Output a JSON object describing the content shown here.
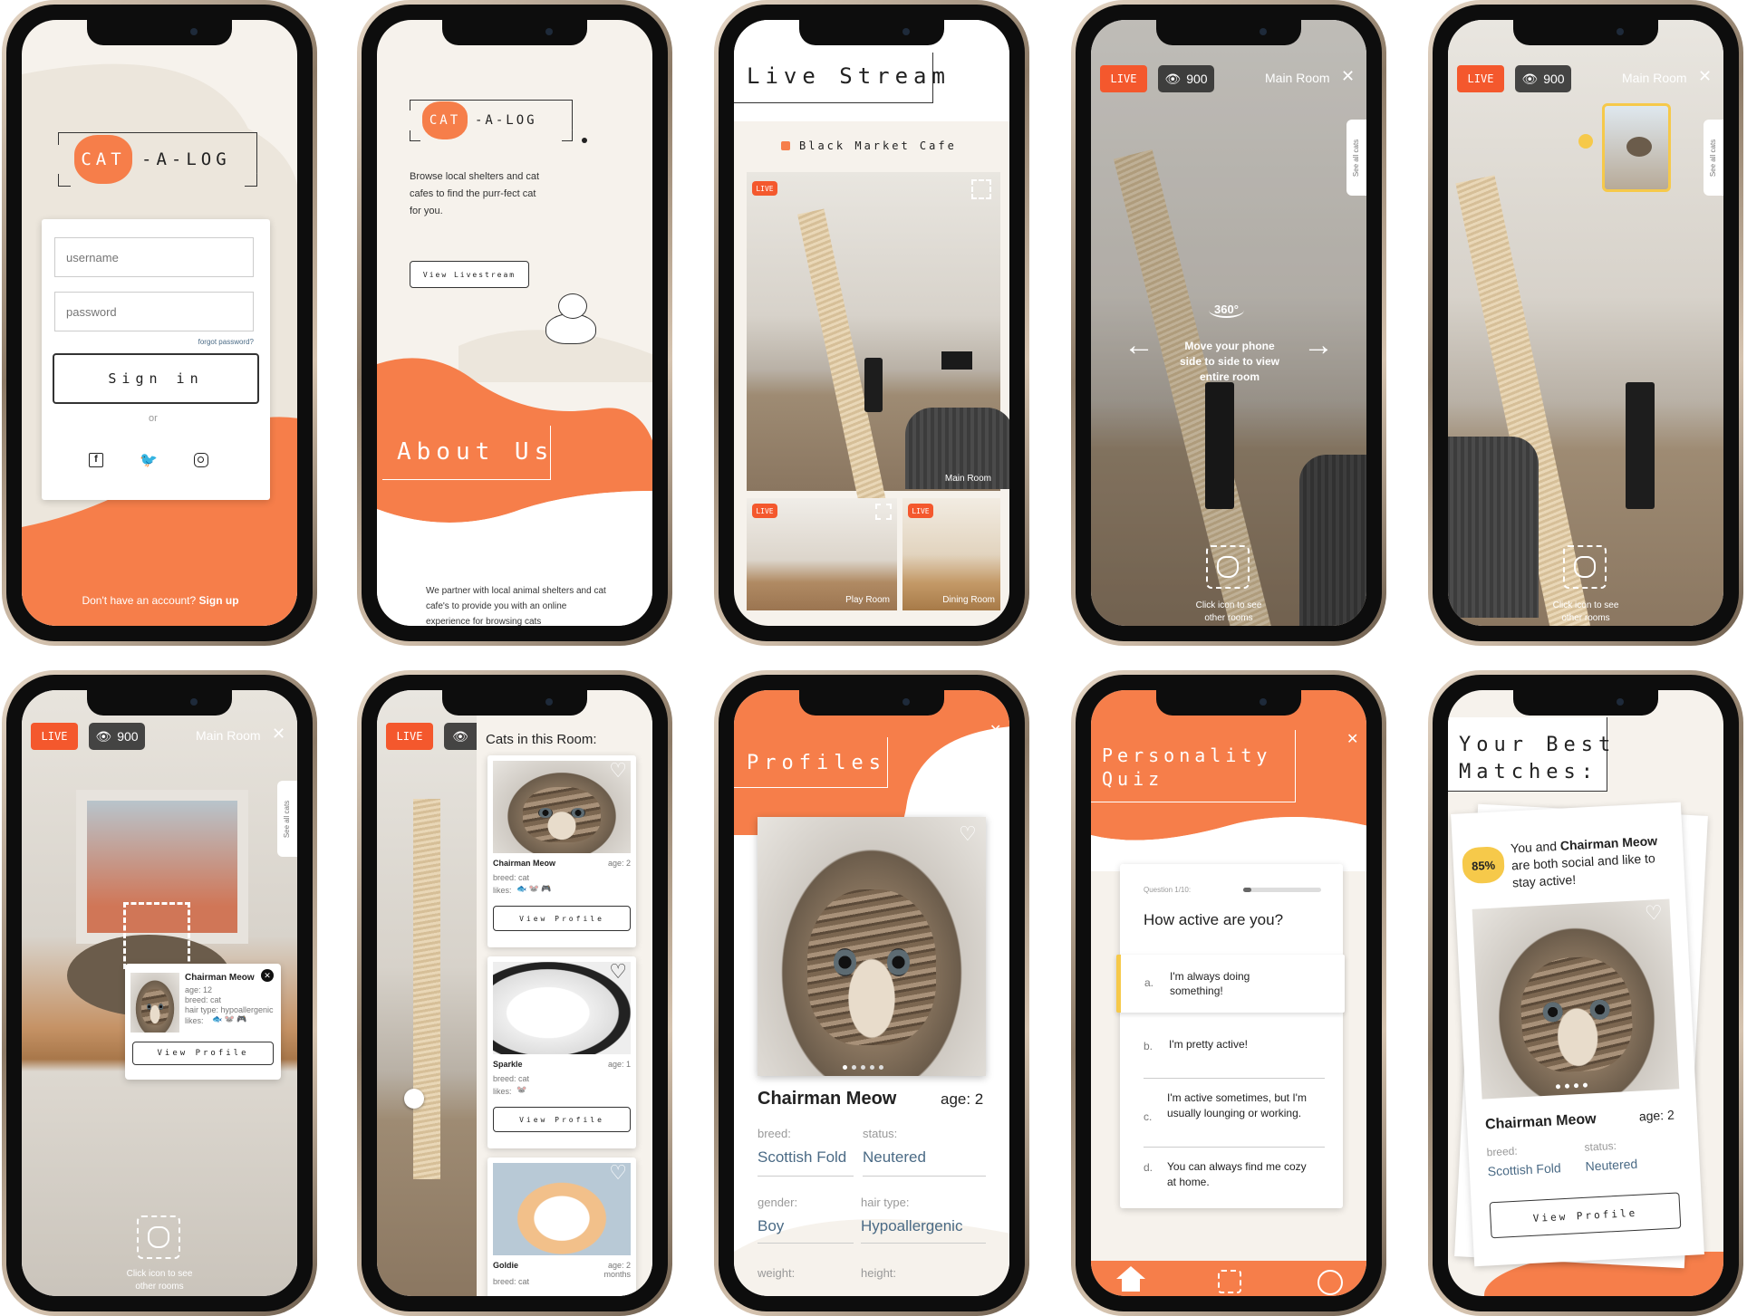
{
  "login": {
    "logo_cat": "CAT",
    "logo_rest": "-A-LOG",
    "username_placeholder": "username",
    "password_placeholder": "password",
    "forgot": "forgot password?",
    "sign_in": "Sign in",
    "or": "or",
    "no_account": "Don't have an account?",
    "sign_up": "Sign up"
  },
  "about": {
    "logo_cat": "CAT",
    "logo_rest": "-A-LOG",
    "tagline": "Browse local shelters and cat cafes to find the purr-fect cat for you.",
    "view_livestream": "View Livestream",
    "about_title": "About Us",
    "partner_text": "We partner with local animal shelters and cat cafe's to provide you with an online experience for browsing cats"
  },
  "live_stream": {
    "title": "Live Stream",
    "cafe": "Black Market Cafe",
    "live": "LIVE",
    "main_room": "Main Room",
    "play_room": "Play Room",
    "dining_room": "Dining Room"
  },
  "viewer": {
    "live": "LIVE",
    "views": "900",
    "room": "Main Room",
    "see_all": "See all cats",
    "three_sixty": "360°",
    "hint": "Move your phone side to side to view entire room",
    "click_icon": "Click icon to see other rooms"
  },
  "popup": {
    "name": "Chairman Meow",
    "age": "age: 12",
    "breed": "breed: cat",
    "hair": "hair type: hypoallergenic",
    "likes": "likes:",
    "view_profile": "View Profile"
  },
  "cats_room": {
    "title": "Cats in this Room:",
    "cats": [
      {
        "name": "Chairman Meow",
        "age": "age: 2",
        "breed": "breed: cat",
        "likes": "likes:",
        "button": "View Profile"
      },
      {
        "name": "Sparkle",
        "age": "age: 1",
        "breed": "breed: cat",
        "likes": "likes:",
        "button": "View Profile"
      },
      {
        "name": "Goldie",
        "age": "age: 2 months",
        "breed": "breed: cat"
      }
    ]
  },
  "profile": {
    "title": "Profiles",
    "name": "Chairman Meow",
    "age": "age: 2",
    "breed_label": "breed:",
    "breed": "Scottish Fold",
    "status_label": "status:",
    "status": "Neutered",
    "gender_label": "gender:",
    "gender": "Boy",
    "hair_label": "hair type:",
    "hair": "Hypoallergenic",
    "weight_label": "weight:",
    "height_label": "height:"
  },
  "quiz": {
    "title_line1": "Personality",
    "title_line2": "Quiz",
    "question_num": "Question 1/10:",
    "progress": 0.1,
    "question": "How active are you?",
    "options": [
      {
        "letter": "a.",
        "text": "I'm always doing something!"
      },
      {
        "letter": "b.",
        "text": "I'm pretty active!"
      },
      {
        "letter": "c.",
        "text": "I'm active sometimes, but I'm usually lounging or working."
      },
      {
        "letter": "d.",
        "text": "You can always find me cozy at home."
      }
    ]
  },
  "matches": {
    "title_line1": "Your Best",
    "title_line2": "Matches:",
    "percent": "85%",
    "blurb_1": "You and",
    "blurb_2": "Chairman Meow",
    "blurb_3": "are both social and like to stay active!",
    "name": "Chairman Meow",
    "age": "age: 2",
    "breed_label": "breed:",
    "breed": "Scottish Fold",
    "status_label": "status:",
    "status": "Neutered",
    "view_profile": "View Profile"
  },
  "colors": {
    "accent": "#f67e4a",
    "live": "#f4582d",
    "quiz_highlight": "#f6c94a"
  }
}
